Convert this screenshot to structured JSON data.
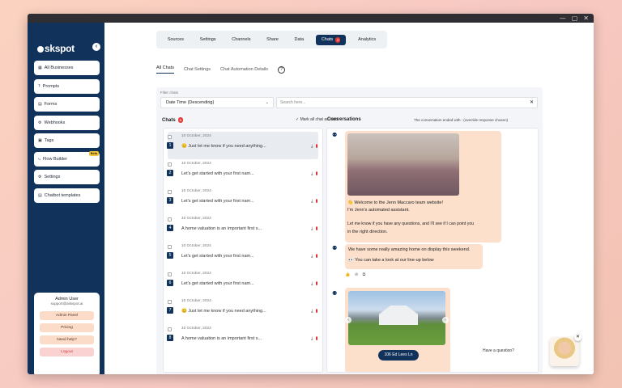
{
  "window": {
    "controls": [
      "—",
      "▢",
      "✕"
    ]
  },
  "sidebar": {
    "logo": "skspot",
    "collapse_icon": "‹",
    "items": [
      {
        "icon": "▦",
        "label": "All Businesses",
        "badge": ""
      },
      {
        "icon": "?",
        "label": "Prompts",
        "badge": ""
      },
      {
        "icon": "▤",
        "label": "Forms",
        "badge": ""
      },
      {
        "icon": "⚙",
        "label": "Webhooks",
        "badge": ""
      },
      {
        "icon": "▣",
        "label": "Tags",
        "badge": ""
      },
      {
        "icon": "⤷",
        "label": "Flow Builder",
        "badge": "Beta"
      },
      {
        "icon": "⚙",
        "label": "Settings",
        "badge": ""
      },
      {
        "icon": "▤",
        "label": "Chatbot templates",
        "badge": ""
      }
    ],
    "user": {
      "name": "Admin User",
      "email": "support@askspot.ai",
      "buttons": [
        "Admin Panel",
        "Pricing",
        "Need help?",
        "Logout"
      ]
    }
  },
  "tabs": {
    "items": [
      "Sources",
      "Settings",
      "Channels",
      "Share",
      "Data",
      "Chats",
      "Analytics"
    ],
    "active": "Chats",
    "chats_badge": "0"
  },
  "subtabs": [
    "All Chats",
    "Chat Settings",
    "Chat Automation Details"
  ],
  "filters": {
    "label": "Filter chats",
    "sort": "Date Time (Descending)",
    "search_placeholder": "Search here...",
    "clear": "✕"
  },
  "chats": {
    "header": "Chats",
    "count": "0",
    "mark_all": "Mark all chat as read",
    "rows": [
      {
        "num": "1",
        "date": "10 October, 2024",
        "preview": "😊 Just let me know if you need anything..."
      },
      {
        "num": "2",
        "date": "10 October, 2024",
        "preview": "Let's get started with your first nam..."
      },
      {
        "num": "3",
        "date": "10 October, 2024",
        "preview": "Let's get started with your first nam..."
      },
      {
        "num": "4",
        "date": "10 October, 2024",
        "preview": "A home valuation is an important first s..."
      },
      {
        "num": "5",
        "date": "10 October, 2024",
        "preview": "Let's get started with your first nam..."
      },
      {
        "num": "6",
        "date": "10 October, 2024",
        "preview": "Let's get started with your first nam..."
      },
      {
        "num": "7",
        "date": "10 October, 2024",
        "preview": "😊 Just let me know if you need anything..."
      },
      {
        "num": "8",
        "date": "10 October, 2024",
        "preview": "A home valuation is an important first s..."
      }
    ]
  },
  "conversation": {
    "header": "Conversations",
    "note": "The conversation ended with : (override response chosen)",
    "msg1": {
      "line1": "👋 Welcome to the Jenn Maccaro team website!",
      "line2": "I'm Jenn's automated assistant.",
      "line3": "Let me know if you have any questions, and I'll see if I can point you",
      "line4": "in the right direction."
    },
    "msg2": {
      "line1": "We have some really amazing home on display this weekend.",
      "line2": "👀 You can take a look at our line-up below"
    },
    "reactions": "👍 ⊘ ⧉",
    "address_button": "106 Ed Lees Ln"
  },
  "help_widget": {
    "text": "Have a question?",
    "close": "✕"
  },
  "colors": {
    "navy": "#11335b",
    "peach": "#fde0cc",
    "red": "#e53935"
  }
}
